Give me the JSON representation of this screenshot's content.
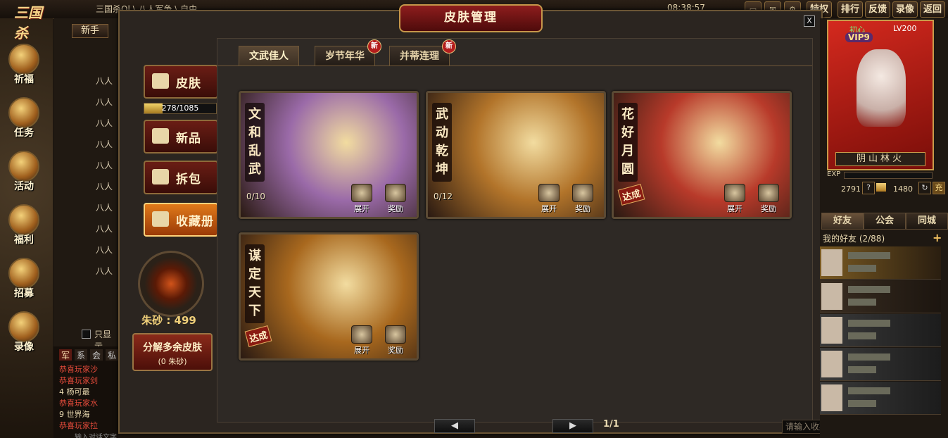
{
  "top_bar": {
    "breadcrumb": "三国杀Ol \\ 八人军争 \\ 自由",
    "time": "08:38:57",
    "buttons": [
      "特权",
      "排行",
      "反馈",
      "录像",
      "返回"
    ]
  },
  "left_sidebar": {
    "logo": "三国杀",
    "tab_newbie": "新手",
    "buttons": [
      "祈福",
      "任务",
      "活动",
      "福利",
      "招募",
      "录像"
    ]
  },
  "left_list": {
    "items": [
      "八人",
      "八人",
      "八人",
      "八人",
      "八人",
      "八人",
      "八人",
      "八人",
      "八人",
      "八人"
    ],
    "only_show": "只显示"
  },
  "chat": {
    "tabs": [
      "军",
      "系",
      "会",
      "私"
    ],
    "lines": [
      "恭喜玩家沙",
      "恭喜玩家剑",
      "4 杨可最",
      "恭喜玩家水",
      "9 世界海",
      "恭喜玩家拉"
    ],
    "input_placeholder": "输入对话文字"
  },
  "dialog": {
    "title": "皮肤管理",
    "close": "X",
    "tabs": [
      {
        "label": "文武佳人",
        "active": true,
        "new": false
      },
      {
        "label": "岁节年华",
        "active": false,
        "new": true
      },
      {
        "label": "并蒂连理",
        "active": false,
        "new": true
      }
    ],
    "new_badge": "新",
    "menu": [
      {
        "label": "皮肤",
        "active": false
      },
      {
        "label": "新品",
        "active": false
      },
      {
        "label": "拆包",
        "active": false
      },
      {
        "label": "收藏册",
        "active": true
      }
    ],
    "skin_progress_text": "278/1085",
    "skin_progress": 0.256,
    "zhusha_text": "朱砂 : 499",
    "decompose_label": "分解多余皮肤",
    "decompose_sub": "(0 朱砂)",
    "cards": [
      {
        "title": "文和乱武",
        "progress": "0/10",
        "completed": false,
        "bg": "#9a6aa8"
      },
      {
        "title": "武动乾坤",
        "progress": "0/12",
        "completed": false,
        "bg": "#b2742a"
      },
      {
        "title": "花好月圆",
        "progress": "",
        "completed": true,
        "bg": "#b83a2a"
      },
      {
        "title": "谋定天下",
        "progress": "",
        "completed": true,
        "bg": "#a8681e"
      }
    ],
    "card_expand": "展开",
    "card_reward": "奖励",
    "completed_label": "达成",
    "page_text": "1/1",
    "prev": "◀",
    "next": "▶",
    "search_placeholder": "请输入收藏册名字"
  },
  "right_panel": {
    "tag": "初心",
    "vip": "VIP9",
    "level": "LV200",
    "nickname": "阴山林火",
    "exp_label": "EXP",
    "currency_1": "2791",
    "currency_2": "1480",
    "tabs": [
      "好友",
      "公会",
      "同城"
    ],
    "my_friends": "我的好友  (2/88)",
    "add": "+"
  }
}
